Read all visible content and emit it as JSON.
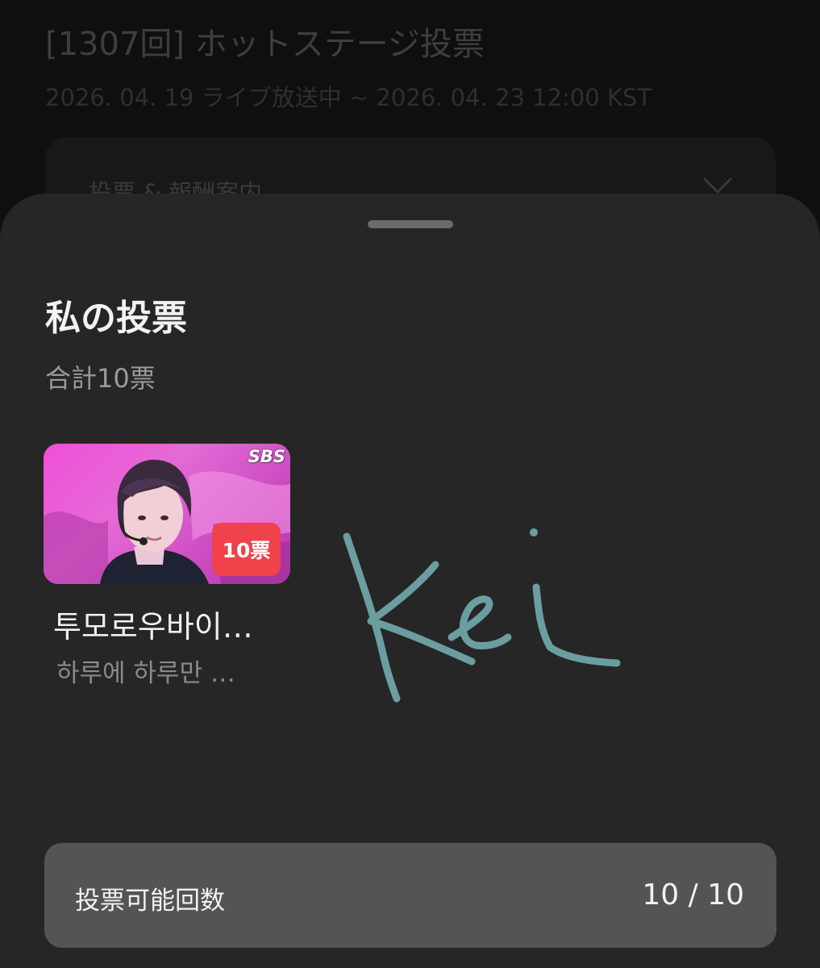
{
  "background": {
    "title": "[1307回] ホットステージ投票",
    "period": "2026. 04. 19 ライブ放送中 ~ 2026. 04. 23 12:00 KST",
    "accordion_label": "投票 & 報酬案内",
    "accordion_icon": "chevron-down-icon"
  },
  "sheet": {
    "title": "私の投票",
    "total": "合計10票",
    "votes": [
      {
        "broadcaster": "SBS",
        "badge": "10票",
        "artist": "투모로우바이…",
        "song": "하루에 하루만 …"
      }
    ],
    "signature": "Kei",
    "vote_count": {
      "label": "投票可能回数",
      "value": "10 / 10"
    }
  },
  "colors": {
    "sheet_bg": "#262626",
    "badge": "#f0424a",
    "signature_ink": "#6a9ea0",
    "count_bar": "#545454"
  }
}
